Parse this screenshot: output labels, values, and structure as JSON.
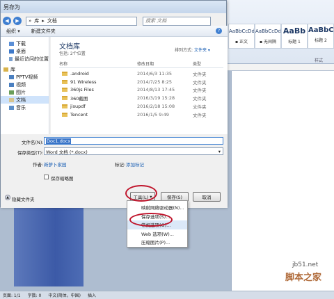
{
  "dialog": {
    "title": "另存为",
    "address_parts": [
      "库",
      "文档"
    ],
    "search_placeholder": "搜索 文档",
    "toolbar": {
      "organize": "组织 ▾",
      "new_folder": "新建文件夹"
    },
    "nav": [
      {
        "label": "下载",
        "group": false
      },
      {
        "label": "桌面",
        "group": false
      },
      {
        "label": "最近访问的位置",
        "group": false
      },
      {
        "label": "库",
        "group": true
      },
      {
        "label": "PPTV视频",
        "group": false
      },
      {
        "label": "视频",
        "group": false
      },
      {
        "label": "图片",
        "group": false
      },
      {
        "label": "文档",
        "group": false,
        "selected": true
      },
      {
        "label": "音乐",
        "group": false
      }
    ],
    "library": {
      "title": "文档库",
      "subtitle": "包括: 2个位置",
      "arrange_label": "排列方式:",
      "arrange_value": "文件夹 ▾"
    },
    "columns": [
      "名称",
      "修改日期",
      "类型"
    ],
    "files": [
      {
        "name": ".android",
        "date": "2014/6/3 11:35",
        "type": "文件夹"
      },
      {
        "name": "91 Wireless",
        "date": "2014/7/25 8:25",
        "type": "文件夹"
      },
      {
        "name": "360js Files",
        "date": "2014/8/13 17:45",
        "type": "文件夹"
      },
      {
        "name": "360截图",
        "date": "2016/3/19 15:28",
        "type": "文件夹"
      },
      {
        "name": "jisupdf",
        "date": "2016/2/18 15:08",
        "type": "文件夹"
      },
      {
        "name": "Tencent",
        "date": "2016/1/5 9:49",
        "type": "文件夹"
      }
    ],
    "filename_label": "文件名(N):",
    "filename_value": "Doc1.docx",
    "filetype_label": "保存类型(T):",
    "filetype_value": "Word 文档 (*.docx)",
    "author_label": "作者:",
    "author_value": "新萝卜家园",
    "tags_label": "标记:",
    "tags_value": "添加标记",
    "thumbnail_label": "保存缩略图",
    "hide_folders": "隐藏文件夹",
    "tools_button": "工具(L)",
    "save_button": "保存(S)",
    "cancel_button": "取消"
  },
  "tools_menu": [
    {
      "label": "映射网络驱动器(N)...",
      "highlighted": false
    },
    {
      "label": "保存选项(S)...",
      "highlighted": false
    },
    {
      "label": "常规选项(G)...",
      "highlighted": true
    },
    {
      "label": "Web 选项(W)...",
      "highlighted": false
    },
    {
      "label": "压缩图片(P)...",
      "highlighted": false
    }
  ],
  "ribbon": {
    "styles": [
      {
        "sample": "AaBbCcDd",
        "name": "▪ 正文"
      },
      {
        "sample": "AaBbCcDd",
        "name": "▪ 无间隔"
      },
      {
        "sample": "AaBb",
        "name": "标题 1"
      },
      {
        "sample": "AaBbC",
        "name": "标题 2"
      }
    ],
    "group_label": "样式"
  },
  "statusbar": [
    "页面: 1/1",
    "字数: 0",
    "中文(简体，中国)",
    "插入"
  ],
  "watermark": {
    "url": "jb51.net",
    "text": "脚本之家"
  }
}
